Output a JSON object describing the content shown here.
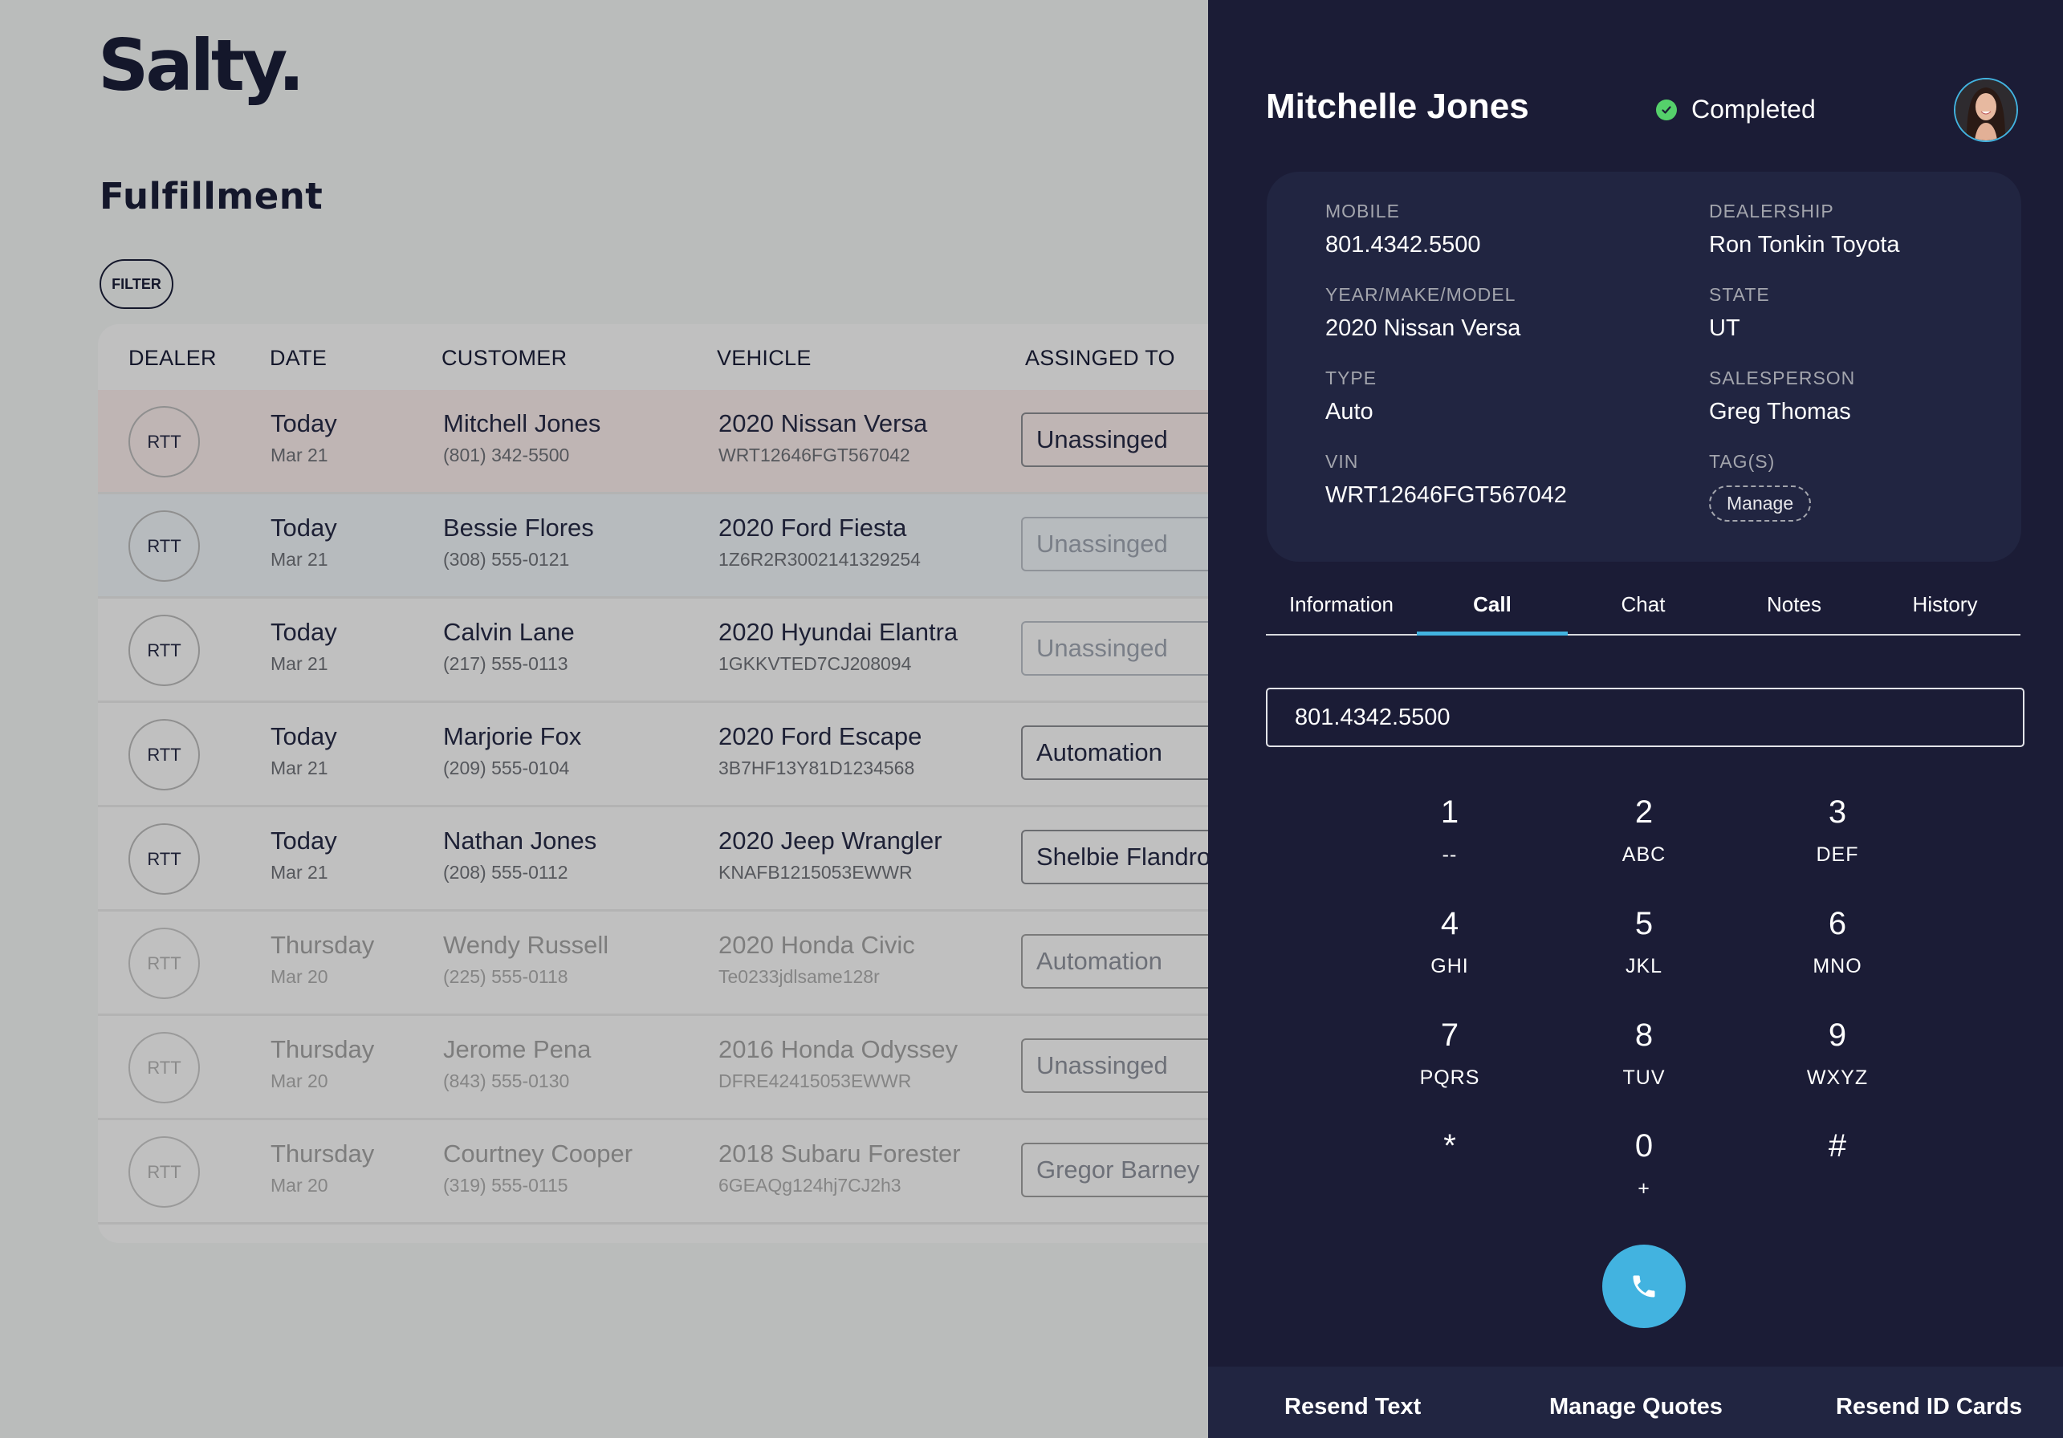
{
  "brand": {
    "logo": "Salty."
  },
  "page": {
    "title": "Fulfillment",
    "filter_label": "FILTER"
  },
  "table": {
    "columns": [
      "DEALER",
      "DATE",
      "CUSTOMER",
      "VEHICLE",
      "ASSINGED TO"
    ],
    "rows": [
      {
        "dealer": "RTT",
        "day": "Today",
        "date": "Mar 21",
        "customer": "Mitchell Jones",
        "phone": "(801) 342-5500",
        "vehicle": "2020 Nissan Versa",
        "vin": "WRT12646FGT567042",
        "assigned": "Unassinged",
        "state": "selected"
      },
      {
        "dealer": "RTT",
        "day": "Today",
        "date": "Mar 21",
        "customer": "Bessie Flores",
        "phone": "(308) 555-0121",
        "vehicle": "2020 Ford Fiesta",
        "vin": "1Z6R2R3002141329254",
        "assigned": "Unassinged",
        "state": "hover"
      },
      {
        "dealer": "RTT",
        "day": "Today",
        "date": "Mar 21",
        "customer": "Calvin Lane",
        "phone": "(217) 555-0113",
        "vehicle": "2020 Hyundai Elantra",
        "vin": "1GKKVTED7CJ208094",
        "assigned": "Unassinged",
        "state": "normal"
      },
      {
        "dealer": "RTT",
        "day": "Today",
        "date": "Mar 21",
        "customer": "Marjorie Fox",
        "phone": "(209) 555-0104",
        "vehicle": "2020 Ford Escape",
        "vin": "3B7HF13Y81D1234568",
        "assigned": "Automation",
        "state": "normal"
      },
      {
        "dealer": "RTT",
        "day": "Today",
        "date": "Mar 21",
        "customer": "Nathan Jones",
        "phone": "(208) 555-0112",
        "vehicle": "2020 Jeep Wrangler",
        "vin": "KNAFB1215053EWWR",
        "assigned": "Shelbie Flandro",
        "state": "normal"
      },
      {
        "dealer": "RTT",
        "day": "Thursday",
        "date": "Mar 20",
        "customer": "Wendy Russell",
        "phone": "(225) 555-0118",
        "vehicle": "2020 Honda Civic",
        "vin": "Te0233jdlsame128r",
        "assigned": "Automation",
        "state": "faded"
      },
      {
        "dealer": "RTT",
        "day": "Thursday",
        "date": "Mar 20",
        "customer": "Jerome Pena",
        "phone": "(843) 555-0130",
        "vehicle": "2016 Honda Odyssey",
        "vin": "DFRE42415053EWWR",
        "assigned": "Unassinged",
        "state": "faded"
      },
      {
        "dealer": "RTT",
        "day": "Thursday",
        "date": "Mar 20",
        "customer": "Courtney Cooper",
        "phone": "(319) 555-0115",
        "vehicle": "2018 Subaru Forester",
        "vin": "6GEAQg124hj7CJ2h3",
        "assigned": "Gregor Barney",
        "state": "faded"
      }
    ]
  },
  "panel": {
    "name": "Mitchelle Jones",
    "status": "Completed",
    "status_icon": "check-circle-icon",
    "status_color": "#55d06b",
    "accent": "#42b3e0",
    "info": {
      "mobile_label": "MOBILE",
      "mobile": "801.4342.5500",
      "dealership_label": "DEALERSHIP",
      "dealership": "Ron Tonkin Toyota",
      "ymm_label": "YEAR/MAKE/MODEL",
      "ymm": "2020 Nissan Versa",
      "state_label": "STATE",
      "state": "UT",
      "type_label": "TYPE",
      "type": "Auto",
      "salesperson_label": "SALESPERSON",
      "salesperson": "Greg Thomas",
      "vin_label": "VIN",
      "vin": "WRT12646FGT567042",
      "tags_label": "TAG(S)",
      "manage_label": "Manage"
    },
    "tabs": [
      "Information",
      "Call",
      "Chat",
      "Notes",
      "History"
    ],
    "active_tab": "Call",
    "dial_value": "801.4342.5500",
    "keypad": [
      {
        "digit": "1",
        "letters": "--"
      },
      {
        "digit": "2",
        "letters": "ABC"
      },
      {
        "digit": "3",
        "letters": "DEF"
      },
      {
        "digit": "4",
        "letters": "GHI"
      },
      {
        "digit": "5",
        "letters": "JKL"
      },
      {
        "digit": "6",
        "letters": "MNO"
      },
      {
        "digit": "7",
        "letters": "PQRS"
      },
      {
        "digit": "8",
        "letters": "TUV"
      },
      {
        "digit": "9",
        "letters": "WXYZ"
      },
      {
        "digit": "*",
        "letters": ""
      },
      {
        "digit": "0",
        "letters": "+"
      },
      {
        "digit": "#",
        "letters": ""
      }
    ],
    "call_icon": "phone-icon",
    "footer": {
      "resend_text": "Resend Text",
      "manage_quotes": "Manage Quotes",
      "resend_id_cards": "Resend ID Cards"
    }
  }
}
